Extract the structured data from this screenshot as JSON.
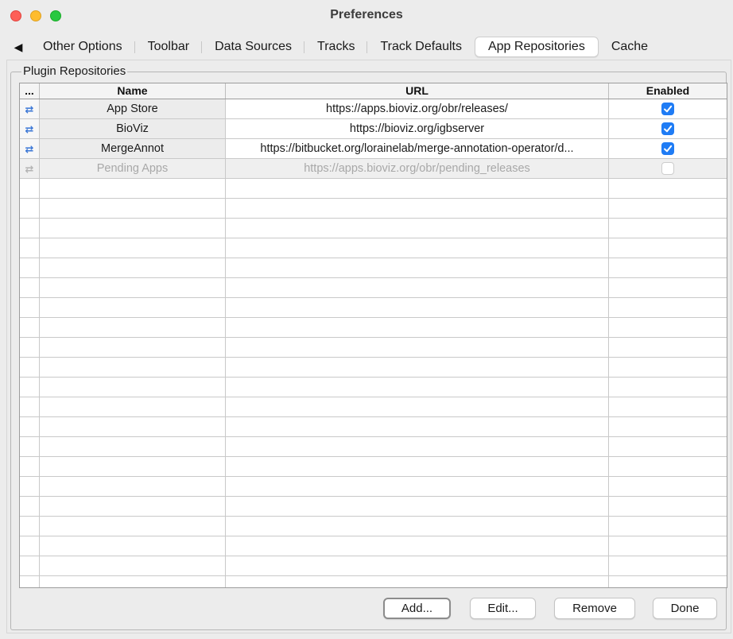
{
  "window": {
    "title": "Preferences"
  },
  "tabs": {
    "scroll_left": "◀",
    "items": [
      {
        "label": "Other Options"
      },
      {
        "label": "Toolbar"
      },
      {
        "label": "Data Sources"
      },
      {
        "label": "Tracks"
      },
      {
        "label": "Track Defaults"
      },
      {
        "label": "App Repositories",
        "active": true
      },
      {
        "label": "Cache"
      }
    ]
  },
  "group": {
    "label": "Plugin Repositories"
  },
  "table": {
    "columns": [
      "...",
      "Name",
      "URL",
      "Enabled"
    ],
    "row_icon": "refresh-icon",
    "rows": [
      {
        "name": "App Store",
        "url": "https://apps.bioviz.org/obr/releases/",
        "enabled": true
      },
      {
        "name": "BioViz",
        "url": "https://bioviz.org/igbserver",
        "enabled": true
      },
      {
        "name": "MergeAnnot",
        "url": "https://bitbucket.org/lorainelab/merge-annotation-operator/d...",
        "enabled": true
      },
      {
        "name": "Pending Apps",
        "url": "https://apps.bioviz.org/obr/pending_releases",
        "enabled": false
      }
    ]
  },
  "buttons": {
    "add": "Add...",
    "edit": "Edit...",
    "remove": "Remove",
    "done": "Done"
  },
  "colors": {
    "accent": "#1f7cf5",
    "close": "#fe5f57",
    "minimize": "#febc2e",
    "zoom": "#28c840"
  }
}
